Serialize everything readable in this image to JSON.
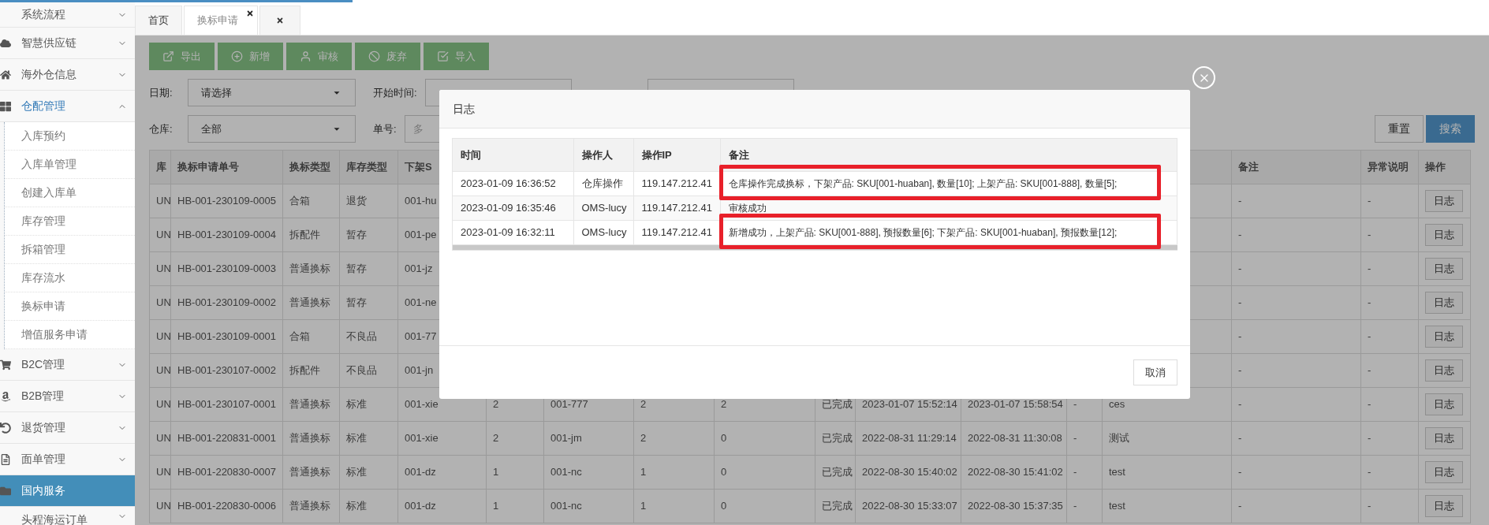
{
  "sidebar": {
    "items": [
      {
        "label": "系统流程",
        "expanded": false
      },
      {
        "label": "智慧供应链",
        "expanded": false
      },
      {
        "label": "海外仓信息",
        "expanded": false
      },
      {
        "label": "仓配管理",
        "expanded": true,
        "children": [
          {
            "label": "入库预约"
          },
          {
            "label": "入库单管理"
          },
          {
            "label": "创建入库单"
          },
          {
            "label": "库存管理"
          },
          {
            "label": "拆箱管理"
          },
          {
            "label": "库存流水"
          },
          {
            "label": "换标申请"
          },
          {
            "label": "增值服务申请"
          }
        ]
      },
      {
        "label": "B2C管理",
        "expanded": false
      },
      {
        "label": "B2B管理",
        "expanded": false
      },
      {
        "label": "退货管理",
        "expanded": false
      },
      {
        "label": "面单管理",
        "expanded": false
      },
      {
        "label": "国内服务",
        "selected": true
      },
      {
        "label": "头程海运订单",
        "expanded": false
      }
    ]
  },
  "tabs": [
    {
      "kind": "page",
      "label": "首页",
      "selected": false,
      "closable": false
    },
    {
      "kind": "page",
      "label": "换标申请",
      "selected": true,
      "closable": true
    },
    {
      "kind": "close-all"
    }
  ],
  "toolbar": [
    "导出",
    "新增",
    "审核",
    "废弃",
    "导入"
  ],
  "filters": [
    [
      {
        "kind": "select",
        "label": "日期:",
        "value": "请选择"
      },
      {
        "kind": "input",
        "label": "开始时间:"
      },
      {
        "kind": "input"
      }
    ],
    [
      {
        "kind": "select",
        "label": "仓库:",
        "value": "全部"
      },
      {
        "kind": "input",
        "label": "单号:",
        "placeholder": "多"
      }
    ]
  ],
  "filter_buttons": [
    {
      "kind": "default",
      "label": "重置"
    },
    {
      "kind": "primary",
      "label": "搜索"
    }
  ],
  "table": {
    "columns_left": [
      "库",
      "换标申请单号",
      "换标类型",
      "库存类型",
      "下架S"
    ],
    "columns_right": [
      "备注",
      "异常说明",
      "操作"
    ],
    "rows": [
      {
        "left": [
          "UN",
          "HB-001-230109-0005",
          "合箱",
          "退货",
          "001-hu"
        ],
        "right": [
          "-",
          "-"
        ],
        "action": "日志"
      },
      {
        "left": [
          "UN",
          "HB-001-230109-0004",
          "拆配件",
          "暂存",
          "001-pe"
        ],
        "right": [
          "-",
          "-"
        ],
        "action": "日志"
      },
      {
        "left": [
          "UN",
          "HB-001-230109-0003",
          "普通换标",
          "暂存",
          "001-jz"
        ],
        "right": [
          "-",
          "-"
        ],
        "action": "日志"
      },
      {
        "left": [
          "UN",
          "HB-001-230109-0002",
          "普通换标",
          "暂存",
          "001-ne"
        ],
        "right": [
          "-",
          "-"
        ],
        "action": "日志"
      },
      {
        "left": [
          "UN",
          "HB-001-230109-0001",
          "合箱",
          "不良品",
          "001-77"
        ],
        "right": [
          "-",
          "-"
        ],
        "action": "日志"
      },
      {
        "left": [
          "UN",
          "HB-001-230107-0002",
          "拆配件",
          "不良品",
          "001-jn"
        ],
        "right": [
          "-",
          "-"
        ],
        "action": "日志"
      },
      {
        "left": [
          "UN",
          "HB-001-230107-0001",
          "普通换标",
          "标准",
          "001-xie"
        ],
        "middle": [
          "2",
          "001-777",
          "2",
          "2",
          "已完成",
          "2023-01-07 15:52:14",
          "2023-01-07 15:58:54",
          "-",
          "ces"
        ],
        "right": [
          "-",
          "-"
        ],
        "action": "日志"
      },
      {
        "left": [
          "UN",
          "HB-001-220831-0001",
          "普通换标",
          "标准",
          "001-xie"
        ],
        "middle": [
          "2",
          "001-jm",
          "2",
          "0",
          "已完成",
          "2022-08-31 11:29:14",
          "2022-08-31 11:30:08",
          "-",
          "测试"
        ],
        "right": [
          "-",
          "-"
        ],
        "action": "日志"
      },
      {
        "left": [
          "UN",
          "HB-001-220830-0007",
          "普通换标",
          "标准",
          "001-dz"
        ],
        "middle": [
          "1",
          "001-nc",
          "1",
          "0",
          "已完成",
          "2022-08-30 15:40:02",
          "2022-08-30 15:41:02",
          "-",
          "test"
        ],
        "right": [
          "-",
          "-"
        ],
        "action": "日志"
      },
      {
        "left": [
          "UN",
          "HB-001-220830-0006",
          "普通换标",
          "标准",
          "001-dz"
        ],
        "middle": [
          "1",
          "001-nc",
          "1",
          "0",
          "已完成",
          "2022-08-30 15:33:07",
          "2022-08-30 15:37:35",
          "-",
          "test"
        ],
        "right": [
          "-",
          "-"
        ],
        "action": "日志"
      }
    ]
  },
  "modal": {
    "title": "日志",
    "columns": [
      "时间",
      "操作人",
      "操作IP",
      "备注"
    ],
    "rows": [
      {
        "time": "2023-01-09 16:36:52",
        "operator": "仓库操作",
        "ip": "119.147.212.41",
        "note": "仓库操作完成换标，下架产品: SKU[001-huaban], 数量[10]; 上架产品: SKU[001-888], 数量[5];",
        "highlighted": true
      },
      {
        "time": "2023-01-09 16:35:46",
        "operator": "OMS-lucy",
        "ip": "119.147.212.41",
        "note": "审核成功",
        "highlighted": false
      },
      {
        "time": "2023-01-09 16:32:11",
        "operator": "OMS-lucy",
        "ip": "119.147.212.41",
        "note": "新增成功，上架产品: SKU[001-888], 预报数量[6]; 下架产品: SKU[001-huaban], 预报数量[12];",
        "highlighted": true
      }
    ],
    "cancel": "取消"
  }
}
